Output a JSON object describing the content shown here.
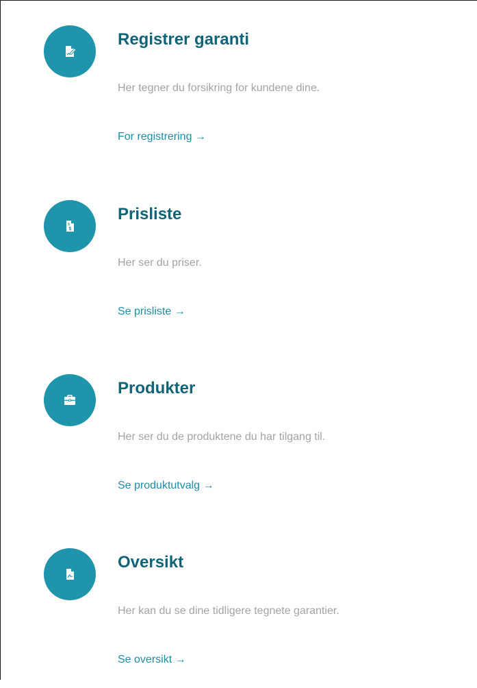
{
  "colors": {
    "accent": "#1f95ab",
    "title": "#0f6478",
    "description": "#a3a3a3",
    "link": "#1a8ea6"
  },
  "cards": [
    {
      "icon": "document-signature-icon",
      "title": "Registrer garanti",
      "description": "Her tegner du forsikring for kundene dine.",
      "link": "For registrering →"
    },
    {
      "icon": "price-document-icon",
      "title": "Prisliste",
      "description": "Her ser du priser.",
      "link": "Se prisliste →"
    },
    {
      "icon": "briefcase-icon",
      "title": "Produkter",
      "description": "Her ser du de produktene du har tilgang til.",
      "link": "Se produktutvalg →"
    },
    {
      "icon": "pdf-document-icon",
      "title": "Oversikt",
      "description": "Her kan du se dine tidligere tegnete garantier.",
      "link": "Se oversikt →"
    }
  ]
}
